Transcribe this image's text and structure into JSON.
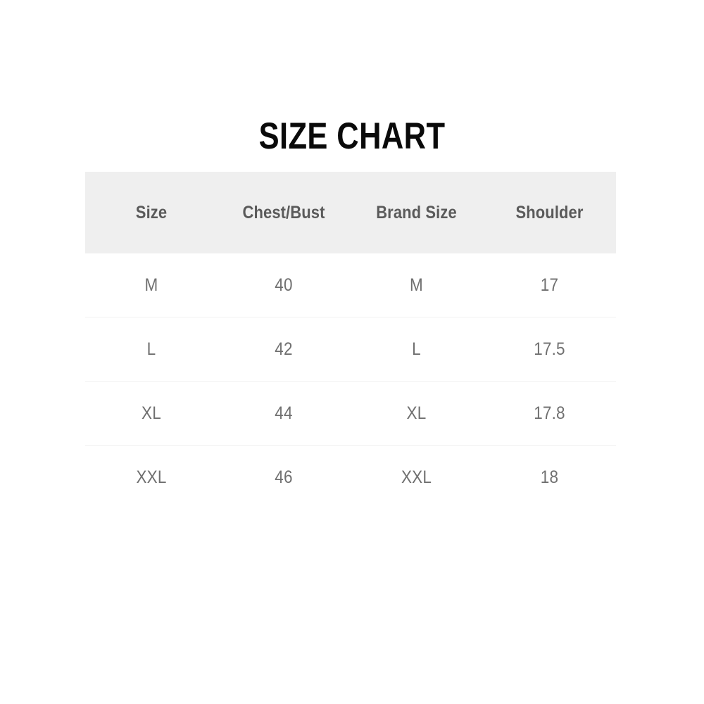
{
  "title": "SIZE CHART",
  "colors": {
    "page_background": "#ffffff",
    "title_text": "#0a0a0a",
    "header_background": "#efefef",
    "header_text": "#5a5a5a",
    "cell_text": "#707070",
    "row_divider": "#f2f2f2"
  },
  "table": {
    "columns": [
      {
        "key": "size",
        "label": "Size"
      },
      {
        "key": "chest",
        "label": "Chest/Bust"
      },
      {
        "key": "brand",
        "label": "Brand Size"
      },
      {
        "key": "shoulder",
        "label": "Shoulder"
      }
    ],
    "rows": [
      {
        "size": "M",
        "chest": "40",
        "brand": "M",
        "shoulder": "17"
      },
      {
        "size": "L",
        "chest": "42",
        "brand": "L",
        "shoulder": "17.5"
      },
      {
        "size": "XL",
        "chest": "44",
        "brand": "XL",
        "shoulder": "17.8"
      },
      {
        "size": "XXL",
        "chest": "46",
        "brand": "XXL",
        "shoulder": "18"
      }
    ]
  },
  "chart_data": {
    "type": "table",
    "title": "SIZE CHART",
    "columns": [
      "Size",
      "Chest/Bust",
      "Brand Size",
      "Shoulder"
    ],
    "rows": [
      [
        "M",
        "40",
        "M",
        "17"
      ],
      [
        "L",
        "42",
        "L",
        "17.5"
      ],
      [
        "XL",
        "44",
        "XL",
        "17.8"
      ],
      [
        "XXL",
        "46",
        "XXL",
        "18"
      ]
    ],
    "categories": [
      "M",
      "L",
      "XL",
      "XXL"
    ],
    "series": [
      {
        "name": "Chest/Bust",
        "values": [
          40,
          42,
          44,
          46
        ]
      },
      {
        "name": "Shoulder",
        "values": [
          17,
          17.5,
          17.8,
          18
        ]
      }
    ],
    "xlabel": "Size",
    "ylabel": "",
    "legend_position": "none",
    "grid": false
  }
}
